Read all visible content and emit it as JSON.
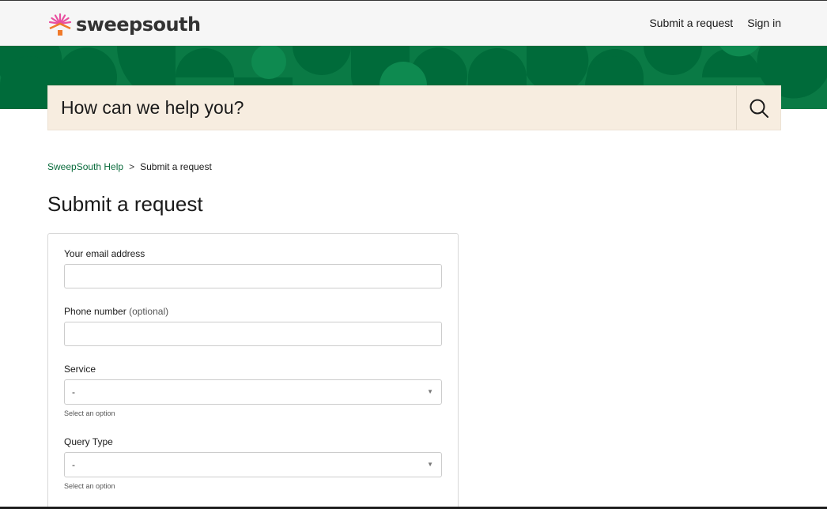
{
  "brand": {
    "name": "sweepsouth",
    "logo_icon": "sweepsouth-sun-house-icon",
    "colors": {
      "green": "#0a7a45",
      "dark_green": "#006b3a",
      "link_green": "#0a6b3c",
      "search_bg": "#f7ede0",
      "logo_pink": "#e94fa0",
      "logo_orange": "#f07a2a"
    }
  },
  "nav": {
    "submit_request": "Submit a request",
    "sign_in": "Sign in"
  },
  "search": {
    "placeholder": "How can we help you?",
    "icon": "search-icon"
  },
  "breadcrumb": {
    "home": "SweepSouth Help",
    "separator": ">",
    "current": "Submit a request"
  },
  "page": {
    "title": "Submit a request"
  },
  "form": {
    "email": {
      "label": "Your email address",
      "value": ""
    },
    "phone": {
      "label": "Phone number",
      "optional": "(optional)",
      "value": ""
    },
    "service": {
      "label": "Service",
      "selected": "-",
      "hint": "Select an option"
    },
    "query_type": {
      "label": "Query Type",
      "selected": "-",
      "hint": "Select an option"
    }
  }
}
